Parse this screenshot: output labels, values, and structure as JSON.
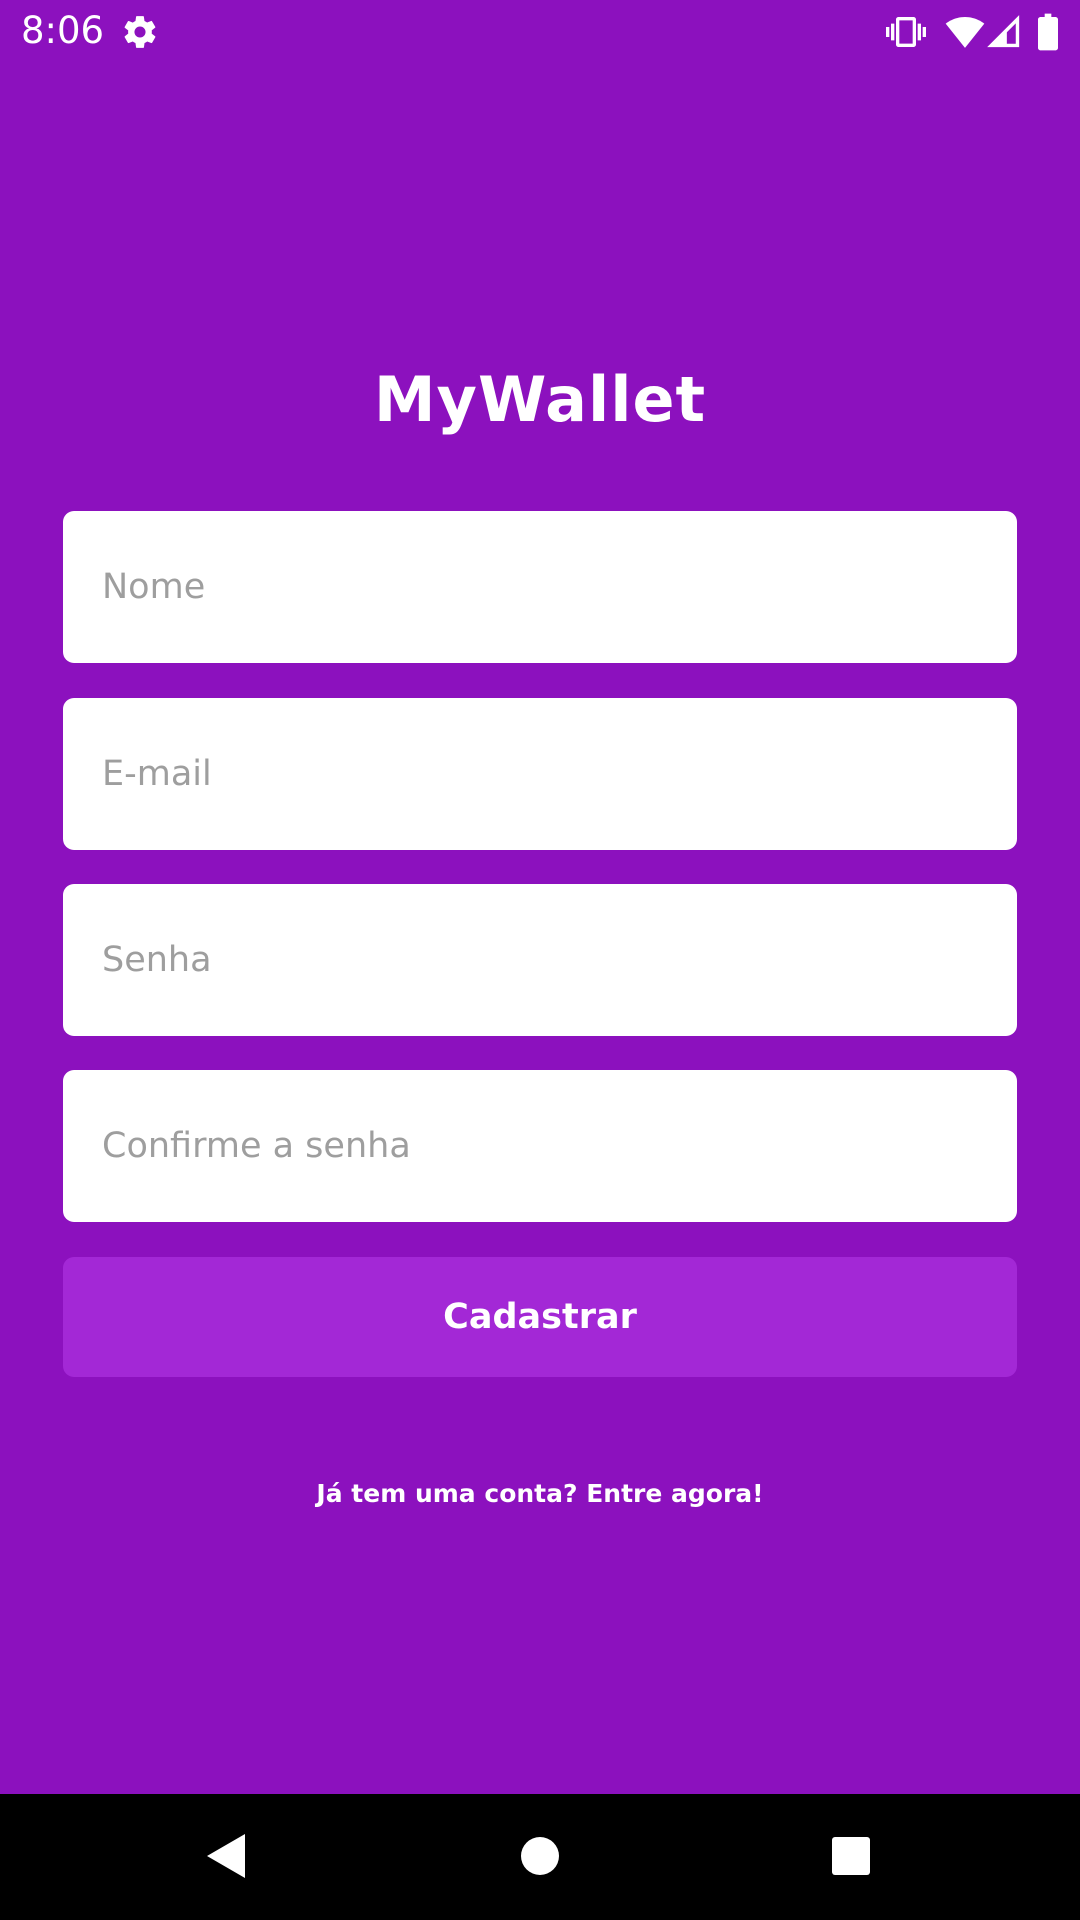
{
  "status_bar": {
    "time": "8:06",
    "icons": [
      "gear-icon",
      "vibrate-icon",
      "wifi-icon",
      "cell-signal-icon",
      "battery-icon"
    ]
  },
  "app": {
    "title": "MyWallet"
  },
  "form": {
    "name_placeholder": "Nome",
    "email_placeholder": "E-mail",
    "password_placeholder": "Senha",
    "confirm_placeholder": "Confirme a senha",
    "submit_label": "Cadastrar"
  },
  "footer": {
    "signin_link": "Já tem uma conta? Entre agora!"
  },
  "colors": {
    "background": "#8C11BE",
    "button": "#A328D6",
    "field": "#FFFFFF",
    "text": "#FFFFFF"
  },
  "nav_bar": {
    "icons": [
      "back-icon",
      "home-icon",
      "recents-icon"
    ]
  }
}
